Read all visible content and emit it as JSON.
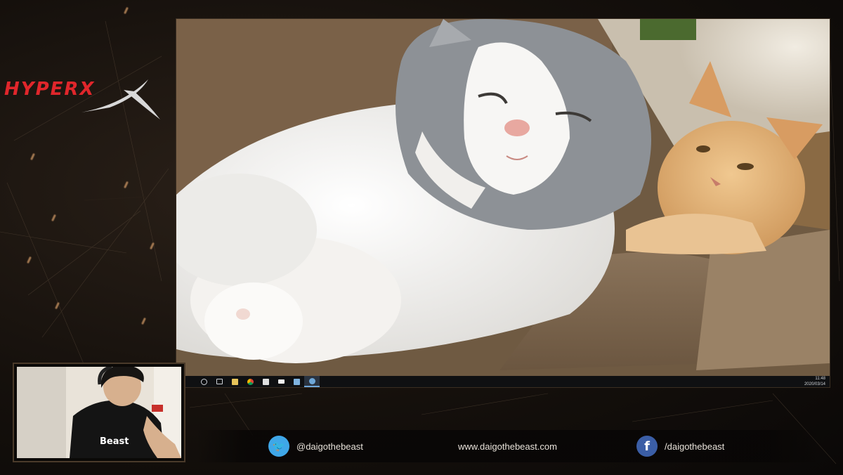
{
  "brand": {
    "logo_text": "HYPERX"
  },
  "stream_overlay": {
    "twitter_handle": "@daigothebeast",
    "website": "www.daigothebeast.com",
    "facebook_handle": "/daigothebeast",
    "twitter_icon_glyph": "🐦",
    "facebook_icon_glyph": "f"
  },
  "desktop": {
    "wallpaper": "two cats on a brown couch",
    "taskbar": {
      "items": [
        "start-circle",
        "task-view",
        "file-explorer",
        "chrome",
        "store",
        "mail",
        "network",
        "steam"
      ],
      "clock_time": "11:48",
      "clock_date": "2020/03/14"
    }
  },
  "webcam": {
    "description": "streamer wearing headset and black beast t-shirt"
  },
  "colors": {
    "accent_red": "#e0262b",
    "twitter_blue": "#3fa7e8",
    "facebook_blue": "#3b5ea6"
  }
}
